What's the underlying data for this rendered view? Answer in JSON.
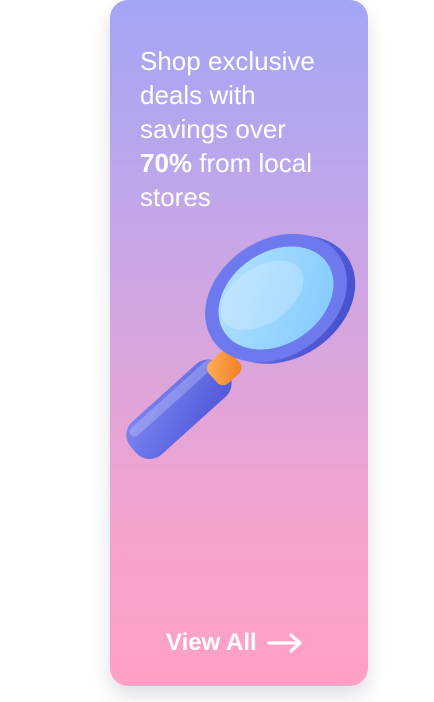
{
  "card": {
    "headline": {
      "line1": "Shop exclusive",
      "line2": "deals with",
      "line3": "savings over",
      "line4_strong": "70%",
      "line4_rest": " from local",
      "line5": "stores"
    },
    "cta_label": "View All",
    "colors": {
      "gradient_top": "#a2a6f6",
      "gradient_bottom": "#ffa0c6",
      "text": "#ffffff"
    },
    "icons": [
      "magnifying-glass-illustration",
      "arrow-right-icon"
    ]
  }
}
